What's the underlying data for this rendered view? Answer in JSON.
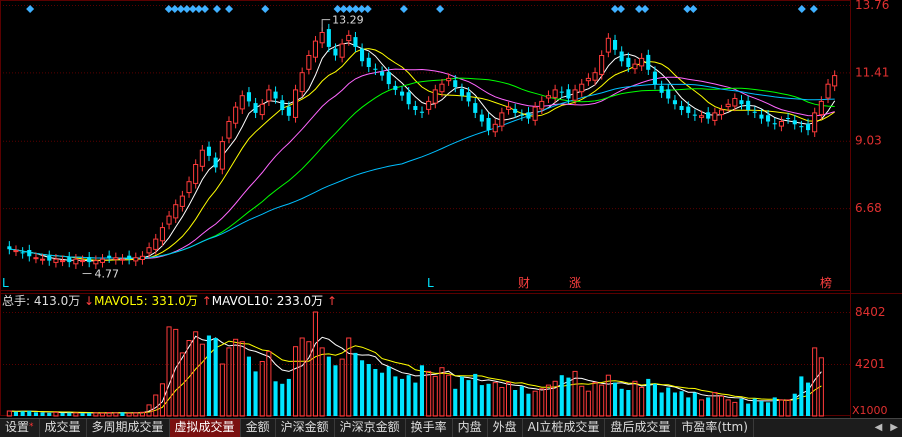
{
  "price_axis": {
    "ticks": [
      "13.76",
      "11.41",
      "9.03",
      "6.68"
    ]
  },
  "price_annotations": {
    "high": "13.29",
    "low": "4.77"
  },
  "event_markers": [
    "L",
    "L",
    "财",
    "涨",
    "榜"
  ],
  "volume_header": {
    "total_label": "总手: 413.0万",
    "ma5_label": "MAVOL5: 331.0万",
    "ma10_label": "MAVOL10: 233.0万"
  },
  "volume_axis": {
    "ticks": [
      "8402",
      "4201"
    ],
    "unit": "X1000"
  },
  "tabs": [
    {
      "label": "设置"
    },
    {
      "label": "成交量"
    },
    {
      "label": "多周期成交量"
    },
    {
      "label": "虚拟成交量",
      "active": true
    },
    {
      "label": "金额"
    },
    {
      "label": "沪深金额"
    },
    {
      "label": "沪深京金额"
    },
    {
      "label": "换手率"
    },
    {
      "label": "内盘"
    },
    {
      "label": "外盘"
    },
    {
      "label": "AI立桩成交量"
    },
    {
      "label": "盘后成交量"
    },
    {
      "label": "市盈率(ttm)"
    }
  ],
  "colors": {
    "up": "#ff3b3b",
    "down": "#00e5ff",
    "ma5": "#ffffff",
    "ma10": "#ffff00",
    "ma20": "#ff66ff",
    "ma30": "#00ff00",
    "ma60": "#00bfff",
    "grid": "#5a0000"
  },
  "chart_data": [
    {
      "type": "candlestick",
      "ylim": [
        4.0,
        13.76
      ],
      "grid": true,
      "close": [
        5.25,
        5.2,
        5.1,
        5.0,
        4.95,
        4.9,
        4.85,
        4.9,
        4.85,
        4.8,
        4.9,
        4.85,
        4.8,
        4.85,
        4.9,
        4.95,
        4.95,
        4.9,
        4.9,
        4.95,
        5.0,
        5.3,
        5.6,
        6.0,
        6.4,
        6.8,
        7.1,
        7.6,
        8.2,
        8.7,
        8.5,
        8.1,
        9.0,
        9.7,
        10.2,
        10.6,
        10.4,
        10.0,
        10.3,
        10.8,
        10.5,
        10.1,
        9.9,
        10.8,
        11.4,
        12.0,
        12.5,
        12.8,
        12.3,
        12.0,
        12.4,
        12.7,
        12.3,
        11.8,
        11.6,
        11.5,
        11.3,
        11.0,
        10.8,
        10.6,
        10.3,
        10.1,
        10.0,
        10.4,
        10.8,
        11.0,
        11.2,
        10.9,
        10.6,
        10.4,
        10.0,
        9.7,
        9.4,
        9.6,
        10.0,
        10.2,
        10.0,
        9.9,
        9.8,
        10.2,
        10.4,
        10.6,
        10.8,
        10.7,
        10.5,
        10.8,
        11.0,
        11.2,
        11.4,
        12.0,
        12.6,
        12.2,
        11.8,
        11.6,
        11.7,
        11.9,
        11.5,
        11.0,
        10.7,
        10.5,
        10.3,
        10.1,
        10.0,
        9.9,
        9.9,
        9.8,
        10.0,
        10.1,
        10.3,
        10.5,
        10.3,
        10.1,
        10.0,
        9.8,
        9.7,
        9.6,
        9.7,
        9.8,
        9.6,
        9.5,
        9.4,
        10.0,
        10.4,
        11.0,
        11.3
      ],
      "ma_periods": [
        5,
        10,
        20,
        30,
        60
      ]
    },
    {
      "type": "bar",
      "title": "volume",
      "ylim": [
        0,
        8402
      ],
      "values": [
        400,
        350,
        380,
        420,
        300,
        280,
        260,
        300,
        250,
        270,
        240,
        230,
        260,
        250,
        230,
        280,
        240,
        300,
        220,
        260,
        300,
        900,
        1700,
        2600,
        7200,
        7000,
        5100,
        6100,
        6800,
        5800,
        6500,
        6300,
        4200,
        5500,
        6200,
        6000,
        4800,
        3600,
        4400,
        5200,
        2800,
        2600,
        3000,
        5600,
        6300,
        6000,
        8402,
        5500,
        4800,
        4100,
        4600,
        6300,
        5100,
        4500,
        4200,
        3800,
        3500,
        4000,
        3200,
        3000,
        3300,
        2700,
        4100,
        3600,
        3200,
        3900,
        3300,
        2200,
        3200,
        2900,
        3400,
        2500,
        2600,
        2700,
        2300,
        2700,
        2100,
        2400,
        1800,
        2000,
        2200,
        2500,
        2800,
        3300,
        3100,
        3600,
        2400,
        2000,
        2700,
        2500,
        3300,
        2700,
        2200,
        2100,
        2800,
        2300,
        3000,
        2600,
        1900,
        2300,
        1900,
        2000,
        1500,
        1900,
        1300,
        1500,
        1900,
        1600,
        1300,
        1100,
        1400,
        1000,
        1400,
        1200,
        1100,
        1500,
        1300,
        1300,
        1800,
        3200,
        2700,
        5500,
        4700
      ]
    }
  ]
}
